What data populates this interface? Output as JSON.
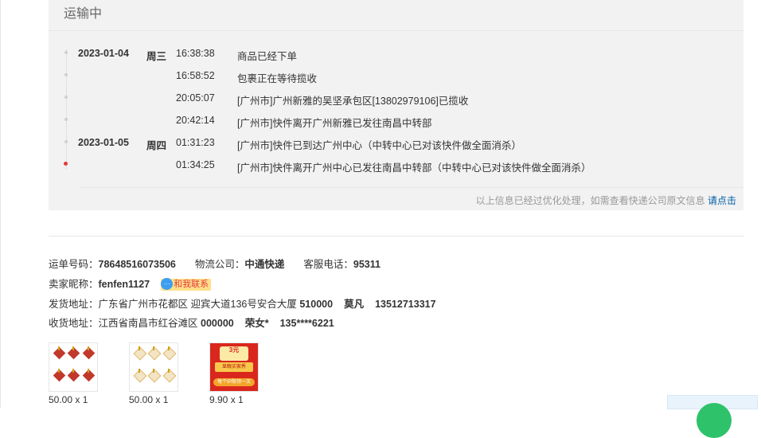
{
  "tracking": {
    "status_title": "运输中",
    "events": [
      {
        "date": "2023-01-04",
        "weekday": "周三",
        "time": "16:38:38",
        "text": "商品已经下单"
      },
      {
        "date": "",
        "weekday": "",
        "time": "16:58:52",
        "text": "包裹正在等待揽收"
      },
      {
        "date": "",
        "weekday": "",
        "time": "20:05:07",
        "text": "[广州市]广州新雅的吴坚承包区[13802979106]已揽收"
      },
      {
        "date": "",
        "weekday": "",
        "time": "20:42:14",
        "text": "[广州市]快件离开广州新雅已发往南昌中转部"
      },
      {
        "date": "2023-01-05",
        "weekday": "周四",
        "time": "01:31:23",
        "text": "[广州市]快件已到达广州中心（中转中心已对该快件做全面消杀）"
      },
      {
        "date": "",
        "weekday": "",
        "time": "01:34:25",
        "text": "[广州市]快件离开广州中心已发往南昌中转部（中转中心已对该快件做全面消杀）"
      }
    ],
    "note_text": "以上信息已经过优化处理，如需查看快递公司原文信息",
    "note_link": "请点击",
    "colors": {
      "active_dot": "#e4393c",
      "link": "#005ea7"
    }
  },
  "info": {
    "waybill_label": "运单号码：",
    "waybill_value": "78648516073506",
    "carrier_label": "物流公司：",
    "carrier_value": "中通快递",
    "service_label": "客服电话：",
    "service_value": "95311",
    "seller_label": "卖家昵称：",
    "seller_value": "fenfen1127",
    "contact_badge": "和我联系",
    "ship_from_label": "发货地址：",
    "ship_from_address": "广东省广州市花都区 迎宾大道136号安合大厦",
    "ship_from_zip": "510000",
    "ship_from_name": "莫凡",
    "ship_from_phone": "13512713317",
    "ship_to_label": "收货地址：",
    "ship_to_address": "江西省南昌市红谷滩区",
    "ship_to_zip": "000000",
    "ship_to_name": "荣女*",
    "ship_to_phone": "135****6221"
  },
  "products": [
    {
      "price": "50.00 x 1",
      "image": "red-envelope-set"
    },
    {
      "price": "50.00 x 1",
      "image": "cream-envelope-set"
    },
    {
      "price": "9.90 x 1",
      "image": "red-promo-card",
      "promo_top": "3元",
      "promo_mid": "显眼买家秀",
      "promo_bot": "每个IP限领一次"
    }
  ]
}
